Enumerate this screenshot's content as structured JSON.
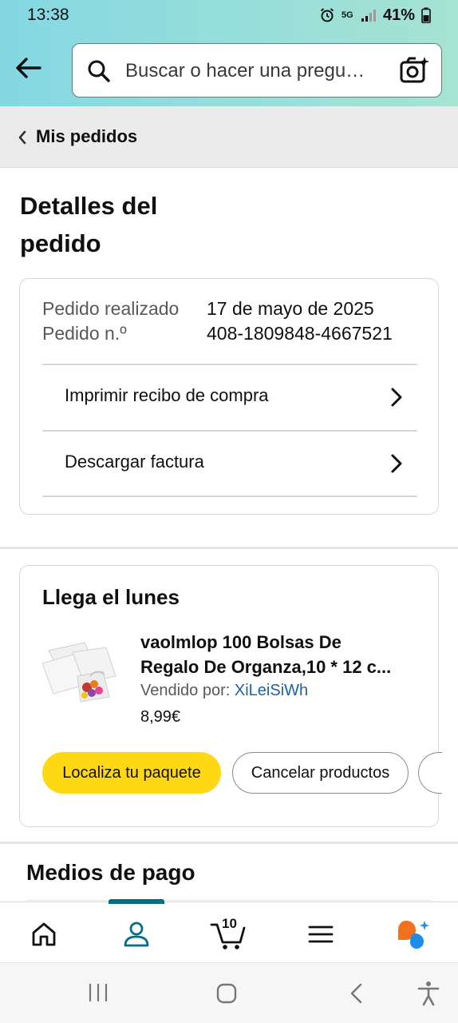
{
  "status_bar": {
    "time": "13:38",
    "network": "5G",
    "battery": "41%"
  },
  "search": {
    "placeholder": "Buscar o hacer una pregu…"
  },
  "breadcrumb": {
    "label": "Mis pedidos"
  },
  "page": {
    "title_line1": "Detalles del",
    "title_line2": "pedido"
  },
  "order_info": {
    "placed_label": "Pedido realizado",
    "placed_value": "17 de mayo de 2025",
    "number_label": "Pedido n.º",
    "number_value": "408-1809848-4667521",
    "links": [
      {
        "label": "Imprimir recibo de compra"
      },
      {
        "label": "Descargar factura"
      }
    ]
  },
  "shipment": {
    "heading": "Llega el lunes",
    "product": {
      "title_line1": "vaolmlop 100 Bolsas De",
      "title_line2": "Regalo De Organza,10 * 12 c...",
      "sold_by_label": "Vendido por:",
      "seller": "XiLeiSiWh",
      "price": "8,99€"
    },
    "buttons": {
      "track": "Localiza tu paquete",
      "cancel": "Cancelar productos"
    }
  },
  "payment": {
    "heading": "Medios de pago"
  },
  "bottom_nav": {
    "cart_count": "10",
    "active_item": "account"
  },
  "colors": {
    "header_gradient_start": "#84d8e3",
    "header_gradient_end": "#a6e3d2",
    "primary_button": "#ffd814",
    "link": "#2162a1",
    "active_nav": "#007185",
    "assistant_orange": "#f3701c",
    "assistant_blue": "#1b8eea"
  }
}
